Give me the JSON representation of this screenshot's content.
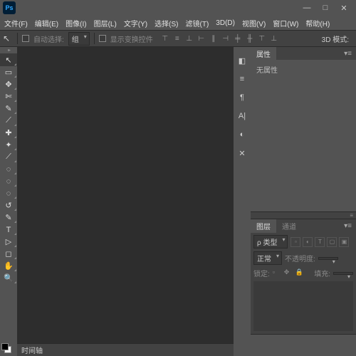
{
  "app": {
    "logo": "Ps"
  },
  "windowControls": {
    "min": "—",
    "max": "□",
    "close": "✕"
  },
  "menu": [
    "文件(F)",
    "编辑(E)",
    "图像(I)",
    "图层(L)",
    "文字(Y)",
    "选择(S)",
    "滤镜(T)",
    "3D(D)",
    "视图(V)",
    "窗口(W)",
    "帮助(H)"
  ],
  "optionsBar": {
    "autoSelectLabel": "自动选择:",
    "autoSelectValue": "组",
    "showTransformLabel": "显示变换控件",
    "mode3d": "3D 模式:"
  },
  "toolIcons": [
    "↖",
    "▭",
    "✥",
    "✄",
    "✎",
    "⟋",
    "✚",
    "✦",
    "◌",
    "↺",
    "T",
    "▷",
    "◻",
    "✋",
    "🔍"
  ],
  "timeline": {
    "label": "时间轴"
  },
  "sideIcons": [
    "◧",
    "≡",
    "¶",
    "A|",
    "◐",
    "✕"
  ],
  "propertiesPanel": {
    "tab": "属性",
    "content": "无属性"
  },
  "layersPanel": {
    "tab1": "图层",
    "tab2": "通道",
    "kindLabel": "ρ 类型",
    "blendMode": "正常",
    "opacityLabel": "不透明度:",
    "lockLabel": "锁定:",
    "fillLabel": "填充:"
  }
}
